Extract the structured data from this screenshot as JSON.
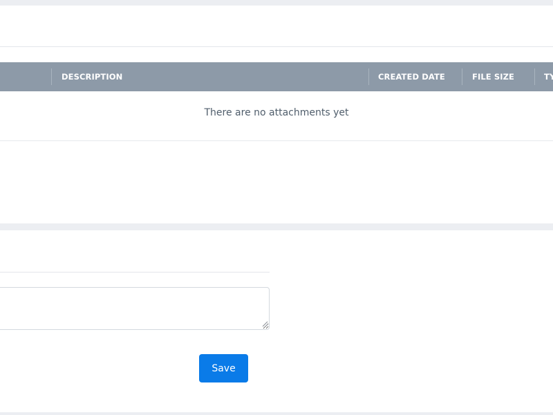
{
  "attachments_table": {
    "columns": [
      {
        "label": ""
      },
      {
        "label": "DESCRIPTION"
      },
      {
        "label": "CREATED DATE"
      },
      {
        "label": "FILE SIZE"
      },
      {
        "label": "TY"
      }
    ],
    "empty_message": "There are no attachments yet"
  },
  "comment_form": {
    "comment_value": "",
    "save_label": "Save"
  }
}
